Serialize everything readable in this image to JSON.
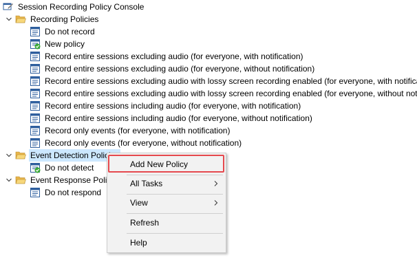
{
  "tree": {
    "root_label": "Session Recording Policy Console",
    "recording": {
      "label": "Recording Policies",
      "items": [
        {
          "label": "Do not record",
          "icon": "policy-icon"
        },
        {
          "label": "New policy",
          "icon": "active-policy-icon"
        },
        {
          "label": "Record entire sessions excluding audio (for everyone, with notification)",
          "icon": "policy-icon"
        },
        {
          "label": "Record entire sessions excluding audio (for everyone, without notification)",
          "icon": "policy-icon"
        },
        {
          "label": "Record entire sessions excluding audio with lossy screen recording enabled (for everyone, with notification)",
          "icon": "policy-icon"
        },
        {
          "label": "Record entire sessions excluding audio with lossy screen recording enabled (for everyone, without notification)",
          "icon": "policy-icon"
        },
        {
          "label": "Record entire sessions including audio (for everyone, with notification)",
          "icon": "policy-icon"
        },
        {
          "label": "Record entire sessions including audio (for everyone, without notification)",
          "icon": "policy-icon"
        },
        {
          "label": "Record only events (for everyone, with notification)",
          "icon": "policy-icon"
        },
        {
          "label": "Record only events (for everyone, without notification)",
          "icon": "policy-icon"
        }
      ]
    },
    "event_detection": {
      "label": "Event Detection Policies",
      "items": [
        {
          "label": "Do not detect",
          "icon": "active-policy-icon"
        }
      ]
    },
    "event_response": {
      "label": "Event Response Policies",
      "items": [
        {
          "label": "Do not respond",
          "icon": "policy-icon"
        }
      ]
    }
  },
  "context_menu": {
    "add_new_policy": "Add New Policy",
    "all_tasks": "All Tasks",
    "view": "View",
    "refresh": "Refresh",
    "help": "Help"
  },
  "colors": {
    "selection": "#cce8ff",
    "highlight_border": "#e5484d",
    "menu_bg": "#f2f2f2",
    "folder": "#f5c75d",
    "policy_blue": "#2f5f9e",
    "active_green": "#3aa935"
  }
}
